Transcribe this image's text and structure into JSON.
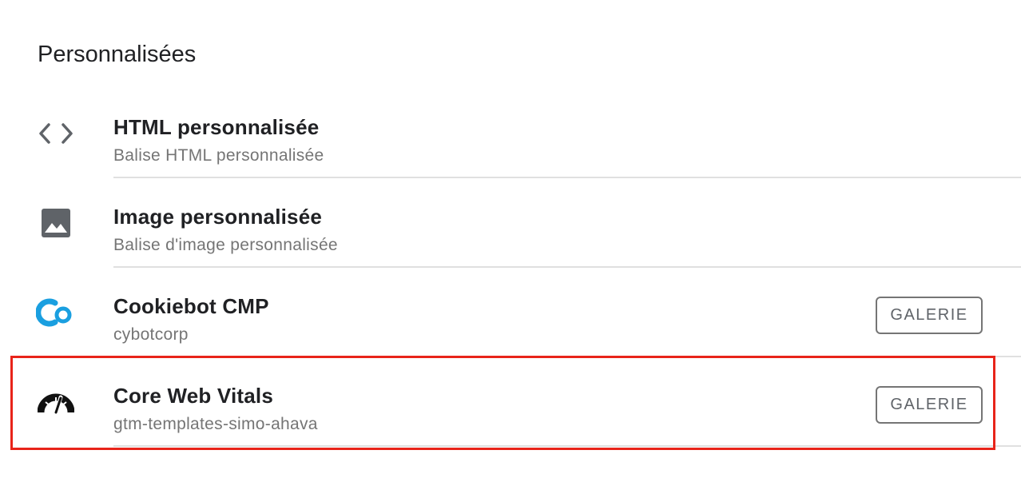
{
  "section": {
    "title": "Personnalisées"
  },
  "items": [
    {
      "title": "HTML personnalisée",
      "subtitle": "Balise HTML personnalisée",
      "icon": "code-icon"
    },
    {
      "title": "Image personnalisée",
      "subtitle": "Balise d'image personnalisée",
      "icon": "image-icon"
    },
    {
      "title": "Cookiebot CMP",
      "subtitle": "cybotcorp",
      "icon": "cookiebot-logo-icon",
      "badge": "GALERIE"
    },
    {
      "title": "Core Web Vitals",
      "subtitle": "gtm-templates-simo-ahava",
      "icon": "speedometer-icon",
      "badge": "GALERIE"
    }
  ],
  "colors": {
    "highlight": "#e8241a",
    "cookiebot": "#1a9fe0",
    "text_primary": "#202124",
    "text_secondary": "#757575"
  }
}
